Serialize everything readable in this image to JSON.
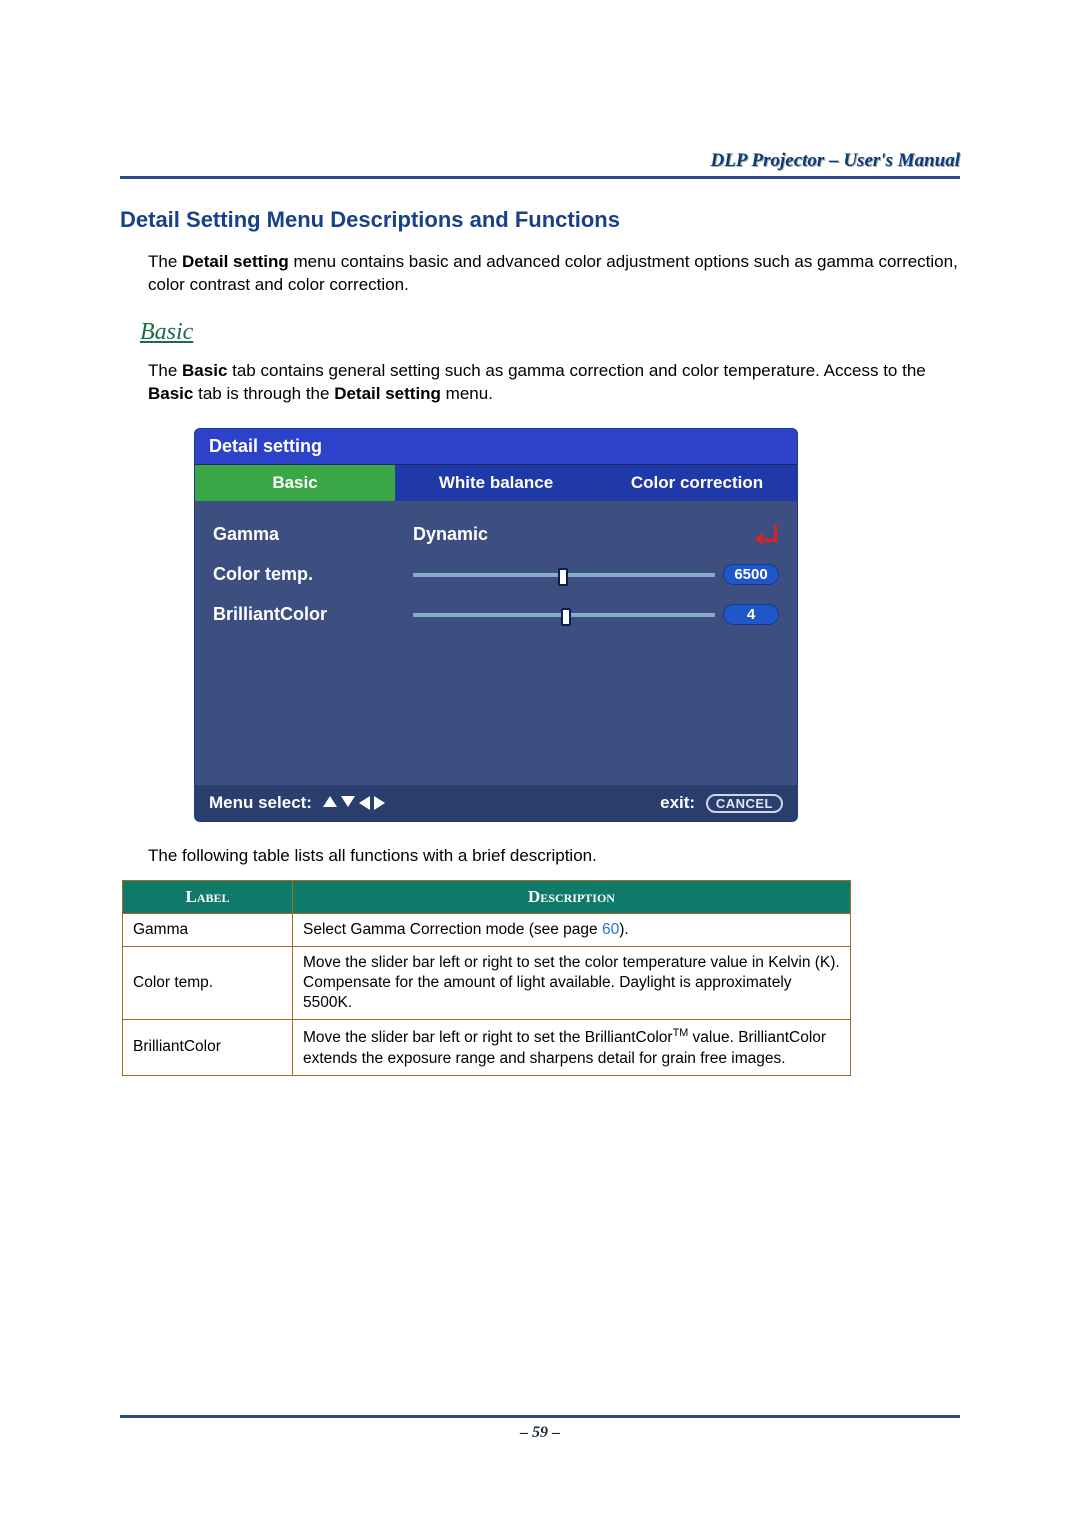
{
  "header": {
    "doc_title": "DLP Projector – User's Manual"
  },
  "section": {
    "title": "Detail Setting Menu Descriptions and Functions",
    "intro_prefix": "The ",
    "intro_bold1": "Detail setting",
    "intro_rest": " menu contains basic and advanced color adjustment options such as gamma correction, color contrast and color correction."
  },
  "basic": {
    "heading": "Basic",
    "p_1": "The ",
    "p_b1": "Basic",
    "p_2": " tab contains general setting such as gamma correction and color temperature. Access to the ",
    "p_b2": "Basic",
    "p_3": " tab is through the ",
    "p_b3": "Detail setting",
    "p_4": " menu."
  },
  "osd": {
    "title": "Detail setting",
    "tabs": {
      "basic": "Basic",
      "white_balance": "White balance",
      "color_correction": "Color correction"
    },
    "rows": {
      "gamma_label": "Gamma",
      "gamma_value": "Dynamic",
      "color_temp_label": "Color temp.",
      "color_temp_value": "6500",
      "brilliant_label": "BrilliantColor",
      "brilliant_value": "4"
    },
    "footer": {
      "menu_select": "Menu select:",
      "exit": "exit:",
      "cancel": "CANCEL"
    }
  },
  "table": {
    "caption": "The following table lists all functions with a brief description.",
    "head": {
      "label": "Label",
      "description": "Description"
    },
    "rows": [
      {
        "label": "Gamma",
        "desc_pre": "Select Gamma Correction mode (see page ",
        "desc_link": "60",
        "desc_post": ")."
      },
      {
        "label": "Color temp.",
        "desc": "Move the slider bar left or right to set the color temperature value in Kelvin (K). Compensate for the amount of light available. Daylight is approximately 5500K."
      },
      {
        "label": "BrilliantColor",
        "desc_pre": "Move the slider bar left or right to set the BrilliantColor",
        "desc_sup": "TM",
        "desc_post": " value. BrilliantColor extends the exposure range and sharpens detail for grain free images."
      }
    ]
  },
  "footer": {
    "page_number": "– 59 –"
  },
  "chart_data": {
    "type": "table",
    "title": "Detail setting > Basic",
    "rows": [
      {
        "label": "Gamma",
        "value": "Dynamic",
        "control": "enum"
      },
      {
        "label": "Color temp.",
        "value": 6500,
        "control": "slider"
      },
      {
        "label": "BrilliantColor",
        "value": 4,
        "control": "slider"
      }
    ]
  }
}
